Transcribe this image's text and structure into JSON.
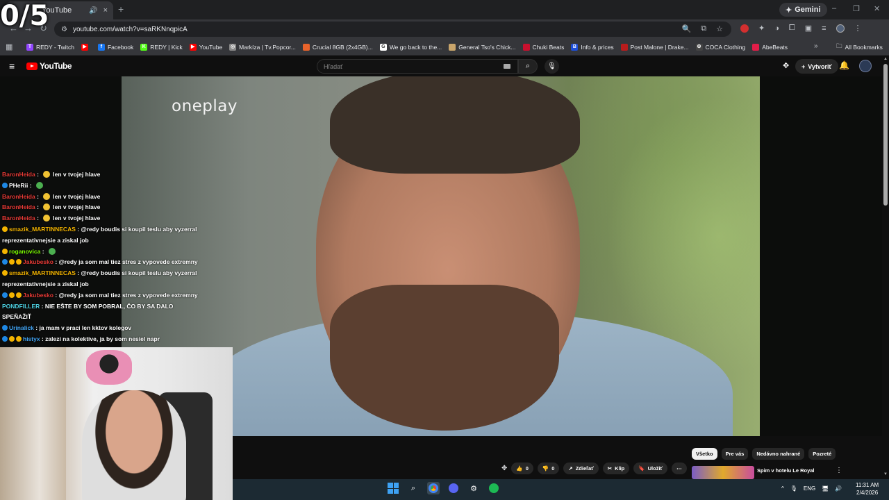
{
  "overlay": {
    "counter": "0/5"
  },
  "browser": {
    "tab": {
      "title": "YouTube",
      "audio_icon": "speaker-icon",
      "close": "×"
    },
    "new_tab": "+",
    "gemini_label": "Gemini",
    "window_controls": [
      "–",
      "❐",
      "✕"
    ],
    "url": "youtube.com/watch?v=saRKNnqpicA",
    "bookmarks": [
      {
        "label": "REDY - Twitch",
        "color": "#9146ff",
        "glyph": "T"
      },
      {
        "label": "",
        "color": "#ff0000",
        "glyph": "▶"
      },
      {
        "label": "Facebook",
        "color": "#1877f2",
        "glyph": "f"
      },
      {
        "label": "REDY | Kick",
        "color": "#53fc18",
        "glyph": "K"
      },
      {
        "label": "YouTube",
        "color": "#ff0000",
        "glyph": "▶"
      },
      {
        "label": "Markíza | Tv.Popcor...",
        "color": "#888888",
        "glyph": "◎"
      },
      {
        "label": "Crucial 8GB (2x4GB)...",
        "color": "#e8632b",
        "glyph": ""
      },
      {
        "label": "We go back to the...",
        "color": "#ffffff",
        "glyph": "G"
      },
      {
        "label": "General Tso's Chick...",
        "color": "#c9a56b",
        "glyph": ""
      },
      {
        "label": "Chuki Beats",
        "color": "#c8102e",
        "glyph": ""
      },
      {
        "label": "Info & prices",
        "color": "#1d4ed8",
        "glyph": "B"
      },
      {
        "label": "Post Malone | Drake...",
        "color": "#b91c1c",
        "glyph": ""
      },
      {
        "label": "COCA Clothing",
        "color": "#444444",
        "glyph": "⚙"
      },
      {
        "label": "AbeBeats",
        "color": "#e11d48",
        "glyph": ""
      }
    ],
    "all_bookmarks": "All Bookmarks"
  },
  "youtube": {
    "logo_text": "YouTube",
    "search_placeholder": "Hľadať",
    "create_label": "Vytvoriť",
    "video": {
      "channel_watermark": "oneplay"
    },
    "actions": [
      {
        "icon": "like-icon",
        "label": "0",
        "glyph": "👍"
      },
      {
        "icon": "dislike-icon",
        "label": "0",
        "glyph": "👎"
      },
      {
        "icon": "share-icon",
        "label": "Zdieľať",
        "glyph": "↗"
      },
      {
        "icon": "clip-icon",
        "label": "Klip",
        "glyph": "✂"
      },
      {
        "icon": "save-icon",
        "label": "Uložiť",
        "glyph": "🔖"
      },
      {
        "icon": "more-icon",
        "label": "⋯",
        "glyph": ""
      }
    ],
    "chips": [
      {
        "label": "Všetko",
        "active": true
      },
      {
        "label": "Pre vás",
        "active": false
      },
      {
        "label": "Nedávno nahrané",
        "active": false
      },
      {
        "label": "Pozreté",
        "active": false
      }
    ],
    "recommendation": {
      "title": "Spim v hotelu Le Royal"
    }
  },
  "chat": [
    {
      "user": "BaronHeida",
      "color": "#e53935",
      "emote": "yellow",
      "msg": "len v tvojej hlave",
      "badges": []
    },
    {
      "user": "PHeRii",
      "color": "#ffffff",
      "emote": "green",
      "msg": "",
      "badges": [
        "#1e88e5"
      ]
    },
    {
      "user": "BaronHeida",
      "color": "#e53935",
      "emote": "yellow",
      "msg": "len v tvojej hlave",
      "badges": []
    },
    {
      "user": "BaronHeida",
      "color": "#e53935",
      "emote": "yellow",
      "msg": "len v tvojej hlave",
      "badges": []
    },
    {
      "user": "BaronHeida",
      "color": "#e53935",
      "emote": "yellow",
      "msg": "len v tvojej hlave",
      "badges": []
    },
    {
      "user": "smazik_MARTINNECAS",
      "color": "#f4b400",
      "emote": "",
      "msg": "@redy boudis si koupil teslu aby vyzerral",
      "badges": [
        "#f4b400"
      ]
    },
    {
      "user": "",
      "color": "#ffffff",
      "emote": "",
      "msg": "reprezentativnejsie a ziskal job",
      "badges": []
    },
    {
      "user": "roganovica",
      "color": "#7cfc00",
      "emote": "green",
      "msg": "",
      "badges": [
        "#f4b400"
      ]
    },
    {
      "user": "Jakubesko",
      "color": "#e53935",
      "emote": "",
      "msg": "@redy ja som mal tiez stres z vypovede extremny",
      "badges": [
        "#1e88e5",
        "#f4b400",
        "#f4b400"
      ]
    },
    {
      "user": "smazik_MARTINNECAS",
      "color": "#f4b400",
      "emote": "",
      "msg": "@redy boudis si koupil teslu aby vyzerral",
      "badges": [
        "#f4b400"
      ]
    },
    {
      "user": "",
      "color": "#ffffff",
      "emote": "",
      "msg": "reprezentativnejsie a ziskal job",
      "badges": []
    },
    {
      "user": "Jakubesko",
      "color": "#e53935",
      "emote": "",
      "msg": "@redy ja som mal tiez stres z vypovede extremny",
      "badges": [
        "#1e88e5",
        "#f4b400",
        "#f4b400"
      ]
    },
    {
      "user": "PONDFILLER",
      "color": "#4dd0e1",
      "emote": "",
      "msg": "NIE EŠTE BY SOM POBRAL, ČO BY SA DALO SPEŇAŽIŤ",
      "badges": []
    },
    {
      "user": "Urinalick",
      "color": "#42a5f5",
      "emote": "",
      "msg": "ja mam v praci len kktov kolegov",
      "badges": [
        "#1e88e5"
      ]
    },
    {
      "user": "histyx",
      "color": "#42a5f5",
      "emote": "",
      "msg": "zalezi na kolektive, ja by som nesiel napr",
      "badges": [
        "#1e88e5",
        "#f4b400",
        "#f4b400"
      ]
    }
  ],
  "taskbar": {
    "language": "ENG",
    "time": "11:31 AM",
    "date": "2/4/2026"
  }
}
